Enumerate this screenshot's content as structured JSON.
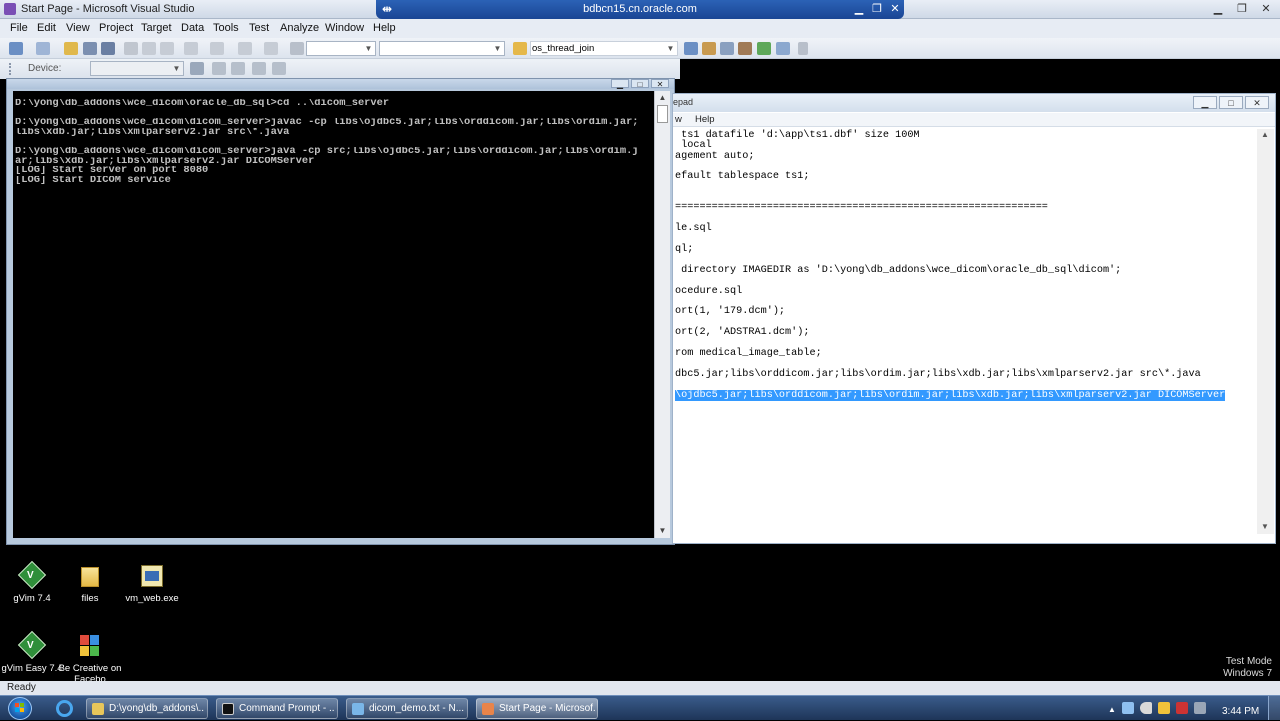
{
  "vs": {
    "title": "Start Page - Microsoft Visual Studio",
    "remote_host": "bdbcn15.cn.oracle.com",
    "menu": [
      "File",
      "Edit",
      "View",
      "Project",
      "Target",
      "Data",
      "Tools",
      "Test",
      "Analyze",
      "Window",
      "Help"
    ],
    "find_combo_value": "os_thread_join",
    "device_label": "Device:"
  },
  "cmd": {
    "lines": [
      "D:\\yong\\db_addons\\wce_dicom\\oracle_db_sql>cd ..\\dicom_server",
      "",
      "D:\\yong\\db_addons\\wce_dicom\\dicom_server>javac -cp libs\\ojdbc5.jar;libs\\orddicom.jar;libs\\ordim.jar;",
      "libs\\xdb.jar;libs\\xmlparserv2.jar src\\*.java",
      "",
      "D:\\yong\\db_addons\\wce_dicom\\dicom_server>java -cp src;libs\\ojdbc5.jar;libs\\orddicom.jar;libs\\ordim.j",
      "ar;libs\\xdb.jar;libs\\xmlparserv2.jar DICOMServer",
      "[LOG] Start server on port 8080",
      "[LOG] Start DICOM service"
    ]
  },
  "notepad": {
    "title_fragment": "epad",
    "menu": [
      "w",
      "Help"
    ],
    "lines": [
      " ts1 datafile 'd:\\app\\ts1.dbf' size 100M",
      " local",
      "agement auto;",
      "efault tablespace ts1;",
      "=============================================================",
      "le.sql",
      "ql;",
      " directory IMAGEDIR as 'D:\\yong\\db_addons\\wce_dicom\\oracle_db_sql\\dicom';",
      "ocedure.sql",
      "ort(1, '179.dcm');",
      "ort(2, 'ADSTRA1.dcm');",
      "rom medical_image_table;",
      "dbc5.jar;libs\\orddicom.jar;libs\\ordim.jar;libs\\xdb.jar;libs\\xmlparserv2.jar src\\*.java",
      "\\ojdbc5.jar;libs\\orddicom.jar;libs\\ordim.jar;libs\\xdb.jar;libs\\xmlparserv2.jar DICOMServer"
    ]
  },
  "desktop": {
    "icons": [
      {
        "label": "gVim 7.4"
      },
      {
        "label": "files"
      },
      {
        "label": "vm_web.exe"
      },
      {
        "label": "gVim Easy 7.4"
      },
      {
        "label": "Be Creative on Facebo"
      }
    ],
    "watermark_line1": "Test Mode",
    "watermark_line2": "Windows 7"
  },
  "status": {
    "text": "Ready"
  },
  "taskbar": {
    "buttons": [
      {
        "label": "D:\\yong\\db_addons\\..."
      },
      {
        "label": "Command Prompt - ..."
      },
      {
        "label": "dicom_demo.txt - N..."
      },
      {
        "label": "Start Page - Microsof..."
      }
    ],
    "clock": "3:44 PM"
  },
  "colors": {
    "selection": "#3399ff",
    "taskbar": "#1e3558",
    "cmd_text": "#c0c0c0"
  }
}
